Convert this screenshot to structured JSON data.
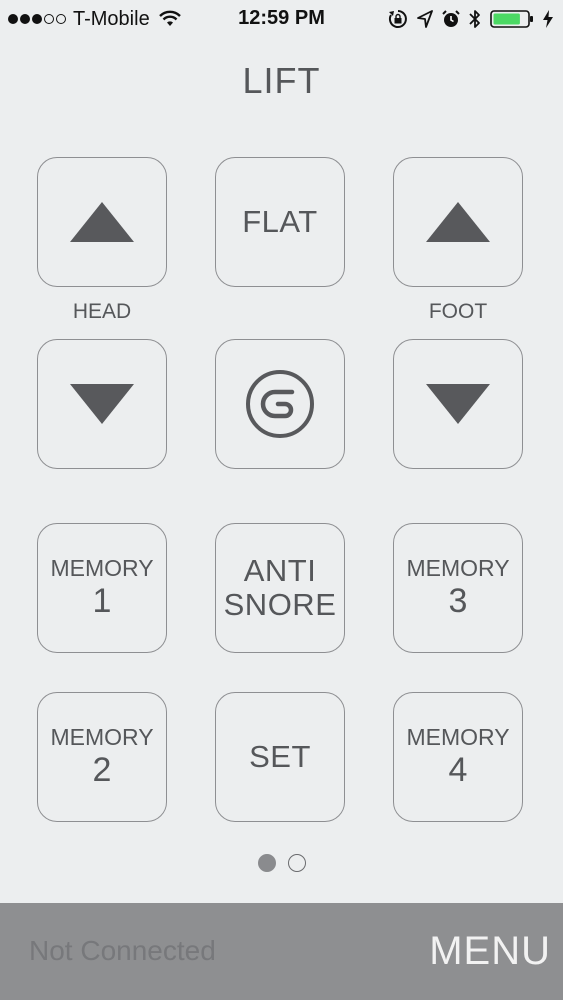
{
  "status_bar": {
    "signal_dots_filled": 3,
    "signal_dots_total": 5,
    "carrier": "T-Mobile",
    "time": "12:59 PM",
    "icons": [
      "wifi-icon",
      "rotation-lock-icon",
      "location-icon",
      "alarm-icon",
      "bluetooth-icon",
      "battery-icon",
      "charging-icon"
    ],
    "battery_level": 0.8,
    "battery_color": "#4cd964"
  },
  "title": "LIFT",
  "controls": {
    "head_label": "HEAD",
    "foot_label": "FOOT",
    "flat": "FLAT",
    "head_up_icon": "triangle-up-icon",
    "head_down_icon": "triangle-down-icon",
    "foot_up_icon": "triangle-up-icon",
    "foot_down_icon": "triangle-down-icon",
    "center_icon": "brand-logo-icon",
    "anti_snore_line1": "ANTI",
    "anti_snore_line2": "SNORE",
    "set": "SET",
    "memory_1_label": "MEMORY",
    "memory_1_num": "1",
    "memory_2_label": "MEMORY",
    "memory_2_num": "2",
    "memory_3_label": "MEMORY",
    "memory_3_num": "3",
    "memory_4_label": "MEMORY",
    "memory_4_num": "4"
  },
  "pager": {
    "pages": 2,
    "current": 1
  },
  "bottom_bar": {
    "status": "Not Connected",
    "menu": "MENU"
  },
  "colors": {
    "background": "#eceeef",
    "bottom_bar": "#8e8f91",
    "button_border": "#8e8f92",
    "icon": "#58595c"
  }
}
